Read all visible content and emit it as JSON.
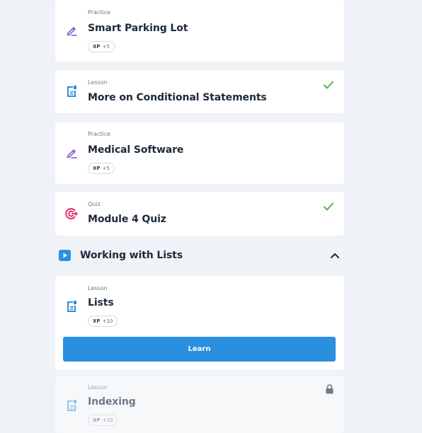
{
  "items": [
    {
      "type": "Practice",
      "title": "Smart Parking Lot",
      "xp_label": "XP",
      "xp_value": "+5",
      "icon": "pencil-icon",
      "status": "none"
    },
    {
      "type": "Lesson",
      "title": "More on Conditional Statements",
      "icon": "lesson-doc-icon",
      "status": "completed"
    },
    {
      "type": "Practice",
      "title": "Medical Software",
      "xp_label": "XP",
      "xp_value": "+5",
      "icon": "pencil-icon",
      "status": "none"
    },
    {
      "type": "Quiz",
      "title": "Module 4 Quiz",
      "icon": "target-icon",
      "status": "completed"
    }
  ],
  "section": {
    "title": "Working with Lists",
    "icon": "play-icon",
    "expanded": true,
    "items": [
      {
        "type": "Lesson",
        "title": "Lists",
        "xp_label": "XP",
        "xp_value": "+10",
        "icon": "lesson-doc-icon",
        "button_label": "Learn",
        "status": "current"
      },
      {
        "type": "Lesson",
        "title": "Indexing",
        "xp_label": "XP",
        "xp_value": "+10",
        "icon": "lesson-doc-icon",
        "status": "locked"
      }
    ]
  },
  "colors": {
    "background": "#eff2f6",
    "card": "#ffffff",
    "accent_blue": "#2b8fe0",
    "check_green": "#4cb84a",
    "pencil_purple": "#7b4cc9",
    "quiz_pink": "#e0316b",
    "title_dark": "#1d2a3a"
  }
}
